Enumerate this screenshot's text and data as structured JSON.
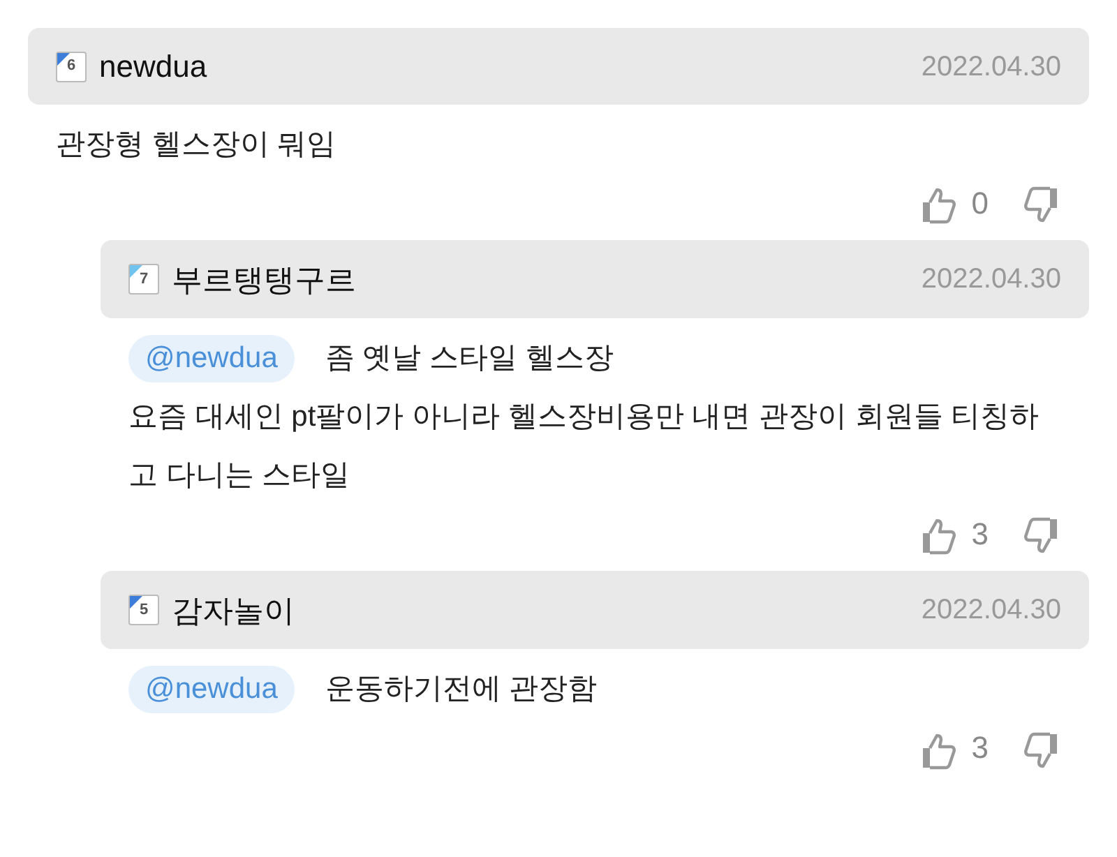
{
  "comments": [
    {
      "level_badge": "6",
      "color": "#3b7dd8",
      "author": "newdua",
      "date": "2022.04.30",
      "lines": [
        "관장형 헬스장이 뭐임"
      ],
      "likes": "0",
      "reply": false
    },
    {
      "level_badge": "7",
      "color": "#6fc3ee",
      "author": "부르탱탱구르",
      "date": "2022.04.30",
      "mention": "@newdua",
      "lines": [
        "좀 옛날 스타일 헬스장",
        "요즘 대세인 pt팔이가 아니라 헬스장비용만 내면 관장이 회원들 티칭하고 다니는 스타일"
      ],
      "likes": "3",
      "reply": true
    },
    {
      "level_badge": "5",
      "color": "#3b7dd8",
      "author": "감자놀이",
      "date": "2022.04.30",
      "mention": "@newdua",
      "lines": [
        "운동하기전에 관장함"
      ],
      "likes": "3",
      "reply": true
    }
  ]
}
